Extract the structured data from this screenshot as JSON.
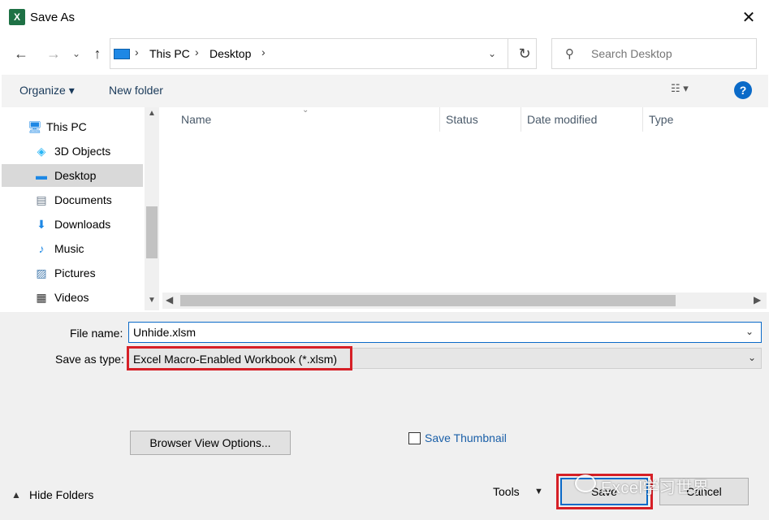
{
  "window": {
    "title": "Save As",
    "app_icon_letter": "X",
    "close_glyph": "✕"
  },
  "nav": {
    "back_glyph": "←",
    "forward_glyph": "→",
    "recent_glyph": "⌄",
    "up_glyph": "↑"
  },
  "address": {
    "breadcrumbs": [
      "This PC",
      "Desktop"
    ],
    "sep_glyph": "›",
    "drop_glyph": "⌄",
    "refresh_glyph": "↻"
  },
  "search": {
    "placeholder": "Search Desktop",
    "icon_glyph": "⚲"
  },
  "toolbar": {
    "organize_label": "Organize ▾",
    "new_folder_label": "New folder",
    "view_glyph": "☷ ▾",
    "help_glyph": "?"
  },
  "sidebar": {
    "items": [
      {
        "label": "This PC",
        "icon": "pc-icon",
        "glyph": "🖥",
        "color": "#1e88e5",
        "selected": false
      },
      {
        "label": "3D Objects",
        "icon": "cube-icon",
        "glyph": "◈",
        "color": "#29b6f6",
        "selected": false
      },
      {
        "label": "Desktop",
        "icon": "desktop-icon",
        "glyph": "▬",
        "color": "#1e88e5",
        "selected": true
      },
      {
        "label": "Documents",
        "icon": "document-icon",
        "glyph": "▤",
        "color": "#6b7a8a",
        "selected": false
      },
      {
        "label": "Downloads",
        "icon": "download-icon",
        "glyph": "⬇",
        "color": "#1e88e5",
        "selected": false
      },
      {
        "label": "Music",
        "icon": "music-icon",
        "glyph": "♪",
        "color": "#1e88e5",
        "selected": false
      },
      {
        "label": "Pictures",
        "icon": "picture-icon",
        "glyph": "▨",
        "color": "#4a7fb0",
        "selected": false
      },
      {
        "label": "Videos",
        "icon": "video-icon",
        "glyph": "▦",
        "color": "#333333",
        "selected": false
      }
    ]
  },
  "filelist": {
    "columns": [
      "Name",
      "Status",
      "Date modified",
      "Type"
    ],
    "sort_glyph": "⌄"
  },
  "form": {
    "file_name_label": "File name:",
    "file_name_value": "Unhide.xlsm",
    "save_type_label": "Save as type:",
    "save_type_value": "Excel Macro-Enabled Workbook (*.xlsm)",
    "drop_glyph": "⌄",
    "browser_view_label": "Browser View Options...",
    "save_thumbnail_label": "Save Thumbnail",
    "hide_folders_label": "Hide Folders",
    "hide_folders_glyph": "▲",
    "tools_label": "Tools",
    "tools_glyph": "▼",
    "save_label": "Save",
    "cancel_label": "Cancel"
  },
  "watermark": {
    "text": "Excel学习世界"
  },
  "colors": {
    "accent": "#0a6ac8",
    "highlight_red": "#d61f26",
    "link_blue": "#1a5fa8"
  }
}
